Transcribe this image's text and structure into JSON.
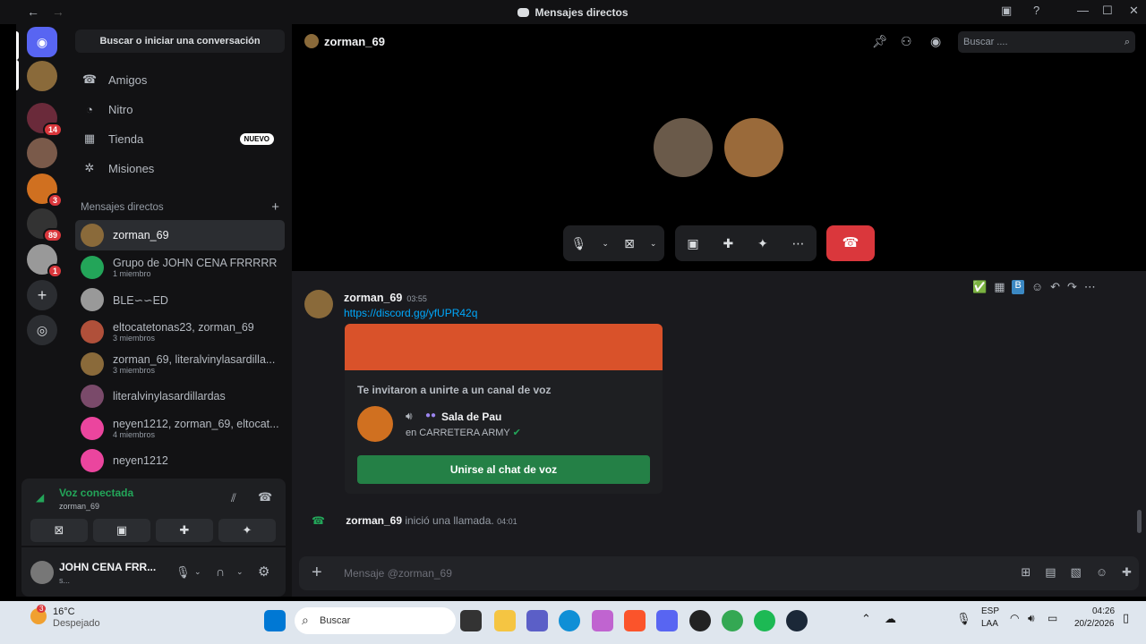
{
  "window": {
    "title": "Mensajes directos",
    "back": "←",
    "forward": "→",
    "min": "—",
    "max": "☐",
    "close": "✕"
  },
  "servers": {
    "badges": [
      "14",
      "3",
      "89",
      "1"
    ]
  },
  "dm_panel": {
    "search_label": "Buscar o iniciar una conversación",
    "nav": [
      {
        "label": "Amigos",
        "icon": "friends-icon"
      },
      {
        "label": "Nitro",
        "icon": "nitro-icon"
      },
      {
        "label": "Tienda",
        "icon": "shop-icon",
        "badge": "NUEVO"
      },
      {
        "label": "Misiones",
        "icon": "quests-icon"
      }
    ],
    "section_label": "Mensajes directos",
    "add": "+",
    "dms": [
      {
        "name": "zorman_69",
        "sub": ""
      },
      {
        "name": "Grupo de JOHN CENA FRRRRR",
        "sub": "1 miembro"
      },
      {
        "name": "BLE∽∽ED",
        "sub": ""
      },
      {
        "name": "eltocatetonas23, zorman_69",
        "sub": "3 miembros"
      },
      {
        "name": "zorman_69, literalvinylasardilla...",
        "sub": "3 miembros"
      },
      {
        "name": "literalvinylasardillardas",
        "sub": ""
      },
      {
        "name": "neyen1212, zorman_69, eltocat...",
        "sub": "4 miembros"
      },
      {
        "name": "neyen1212",
        "sub": ""
      }
    ]
  },
  "voice": {
    "status": "Voz conectada",
    "channel": "zorman_69"
  },
  "user": {
    "name": "JOHN CENA FRR...",
    "status": "s..."
  },
  "header": {
    "channel": "zorman_69",
    "search_placeholder": "Buscar ...."
  },
  "message": {
    "author": "zorman_69",
    "time": "03:55",
    "link": "https://discord.gg/yfUPR42q",
    "invite_title": "Te invitaron a unirte a un canal de voz",
    "channel_name": "Sala de Pau",
    "server_line": "en CARRETERA ARMY",
    "join_label": "Unirse al chat de voz"
  },
  "system": {
    "author": "zorman_69",
    "text": "inició una llamada.",
    "time": "04:01"
  },
  "composer": {
    "placeholder": "Mensaje @zorman_69"
  },
  "taskbar": {
    "temp": "16°C",
    "weather": "Despejado",
    "weather_badge": "3",
    "search": "Buscar",
    "lang1": "ESP",
    "lang2": "LAA",
    "time": "04:26",
    "date": "20/2/2026"
  },
  "colors": {
    "accent": "#5865f2",
    "green": "#23a559",
    "join": "#248046",
    "hangup": "#da373c",
    "link": "#00a8fc"
  }
}
